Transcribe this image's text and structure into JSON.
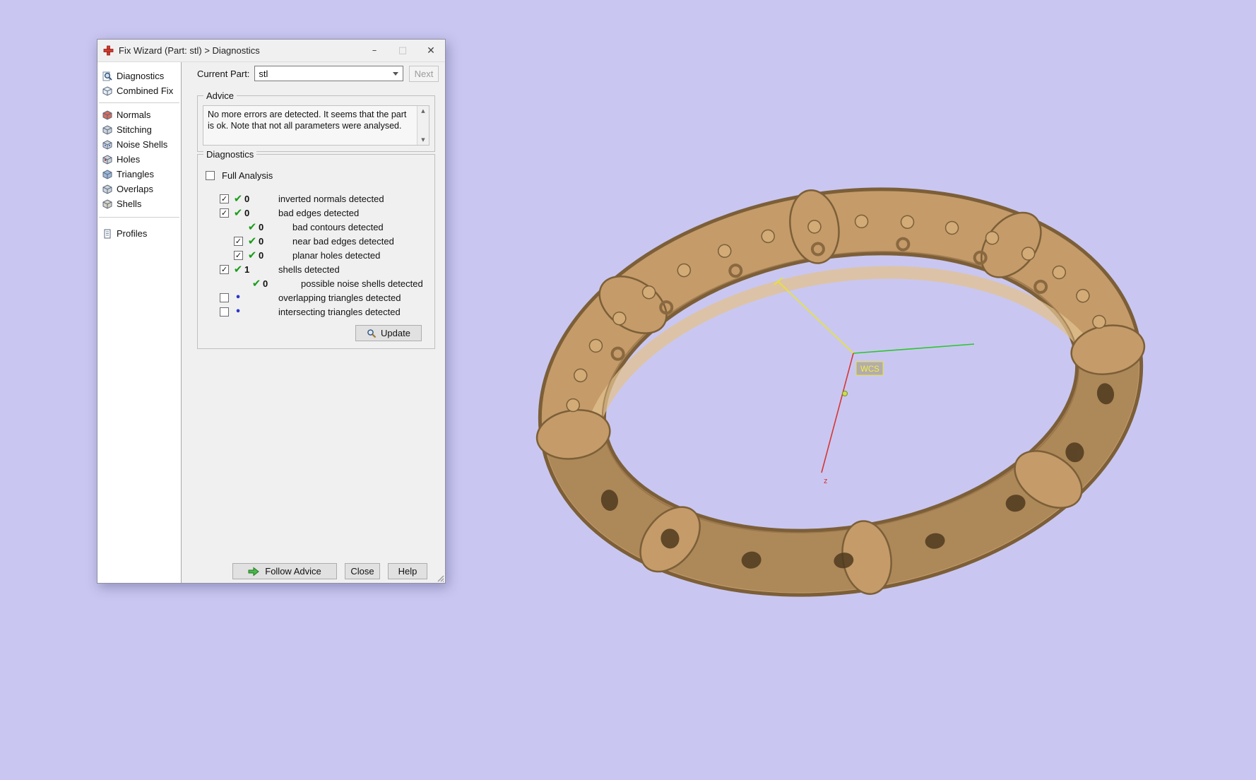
{
  "window": {
    "title": "Fix Wizard (Part: stl) > Diagnostics",
    "minimize_glyph": "–",
    "maximize_glyph": "□",
    "close_glyph": "✕"
  },
  "sidebar": {
    "items": [
      {
        "label": "Diagnostics",
        "icon": "magnifier-icon"
      },
      {
        "label": "Combined Fix",
        "icon": "cube-icon"
      },
      {
        "label": "Normals",
        "icon": "cube-icon"
      },
      {
        "label": "Stitching",
        "icon": "cube-icon"
      },
      {
        "label": "Noise Shells",
        "icon": "cube-icon"
      },
      {
        "label": "Holes",
        "icon": "cube-icon"
      },
      {
        "label": "Triangles",
        "icon": "cube-icon"
      },
      {
        "label": "Overlaps",
        "icon": "cube-icon"
      },
      {
        "label": "Shells",
        "icon": "cube-icon"
      },
      {
        "label": "Profiles",
        "icon": "document-icon"
      }
    ]
  },
  "header": {
    "current_part_label": "Current Part:",
    "current_part_value": "stl",
    "next_label": "Next"
  },
  "advice": {
    "group_label": "Advice",
    "text": "No more errors are detected. It seems that the part is ok. Note that not all parameters were analysed.",
    "scroll_up_glyph": "▲",
    "scroll_down_glyph": "▼"
  },
  "diagnostics": {
    "group_label": "Diagnostics",
    "full_analysis_label": "Full Analysis",
    "full_analysis_checkbox_glyph": "",
    "update_label": "Update",
    "rows": [
      {
        "checkbox_glyph": "✓",
        "status_icon": "green-check-icon",
        "status_glyph": "✔",
        "count": "0",
        "label": "inverted normals detected"
      },
      {
        "checkbox_glyph": "✓",
        "status_icon": "green-check-icon",
        "status_glyph": "✔",
        "count": "0",
        "label": "bad edges detected"
      },
      {
        "status_icon": "green-check-icon",
        "status_glyph": "✔",
        "count": "0",
        "label": "bad contours detected"
      },
      {
        "checkbox_glyph": "✓",
        "status_icon": "green-check-icon",
        "status_glyph": "✔",
        "count": "0",
        "label": "near bad edges detected"
      },
      {
        "checkbox_glyph": "✓",
        "status_icon": "green-check-icon",
        "status_glyph": "✔",
        "count": "0",
        "label": "planar holes detected"
      },
      {
        "checkbox_glyph": "✓",
        "status_icon": "green-check-icon",
        "status_glyph": "✔",
        "count": "1",
        "label": "shells detected"
      },
      {
        "status_icon": "green-check-icon",
        "status_glyph": "✔",
        "count": "0",
        "label": "possible noise shells detected"
      },
      {
        "checkbox_glyph": "",
        "status_icon": "blue-dot-icon",
        "status_glyph": "•",
        "count": "",
        "label": "overlapping triangles detected"
      },
      {
        "checkbox_glyph": "",
        "status_icon": "blue-dot-icon",
        "status_glyph": "•",
        "count": "",
        "label": "intersecting triangles detected"
      }
    ]
  },
  "footer": {
    "follow_advice_label": "Follow Advice",
    "close_label": "Close",
    "help_label": "Help"
  },
  "viewport": {
    "wcs_label": "WCS",
    "z_axis_label": "z"
  },
  "colors": {
    "background": "#c9c7f1",
    "model_tan": "#c49b69",
    "check_green": "#1a9c1a",
    "axis_yellow": "#e9e42e",
    "axis_green": "#2bc62b",
    "axis_red": "#d83434"
  }
}
